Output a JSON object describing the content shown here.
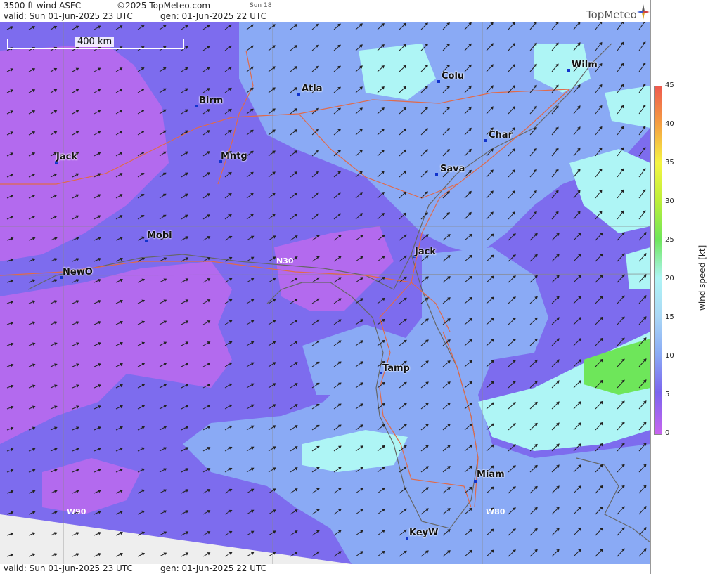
{
  "header": {
    "product": "3500 ft wind ASFC",
    "copyright": "©2025 TopMeteo.com",
    "day_tag": "Sun 18",
    "valid": "valid:  Sun  01-Jun-2025  23 UTC",
    "gen": "gen: 01-Jun-2025 22 UTC",
    "logo": "TopMeteo"
  },
  "footer": {
    "valid": "valid:  Sun  01-Jun-2025  23 UTC",
    "gen": "gen: 01-Jun-2025 22 UTC"
  },
  "scale_bar": "400 km",
  "grid_labels": {
    "n30": "N30",
    "w90": "W90",
    "w80": "W80"
  },
  "cities": [
    "Birm",
    "Atla",
    "Colu",
    "Wilm",
    "Char",
    "Sava",
    "Jack",
    "Mntg",
    "Mobi",
    "NewO",
    "Jack",
    "Tamp",
    "Miam",
    "KeyW"
  ],
  "legend": {
    "title": "wind speed  [kt]",
    "ticks": [
      "45",
      "40",
      "35",
      "30",
      "25",
      "20",
      "15",
      "10",
      "5",
      "0"
    ],
    "colors": {
      "0": "#c864ee",
      "5": "#7b64ee",
      "10": "#8aaaf5",
      "15": "#aad8f5",
      "20": "#aef5f5",
      "25": "#6ee65a",
      "30": "#bcee3a",
      "35": "#f5f542",
      "40": "#f5a042",
      "45": "#ee5a4e"
    }
  }
}
